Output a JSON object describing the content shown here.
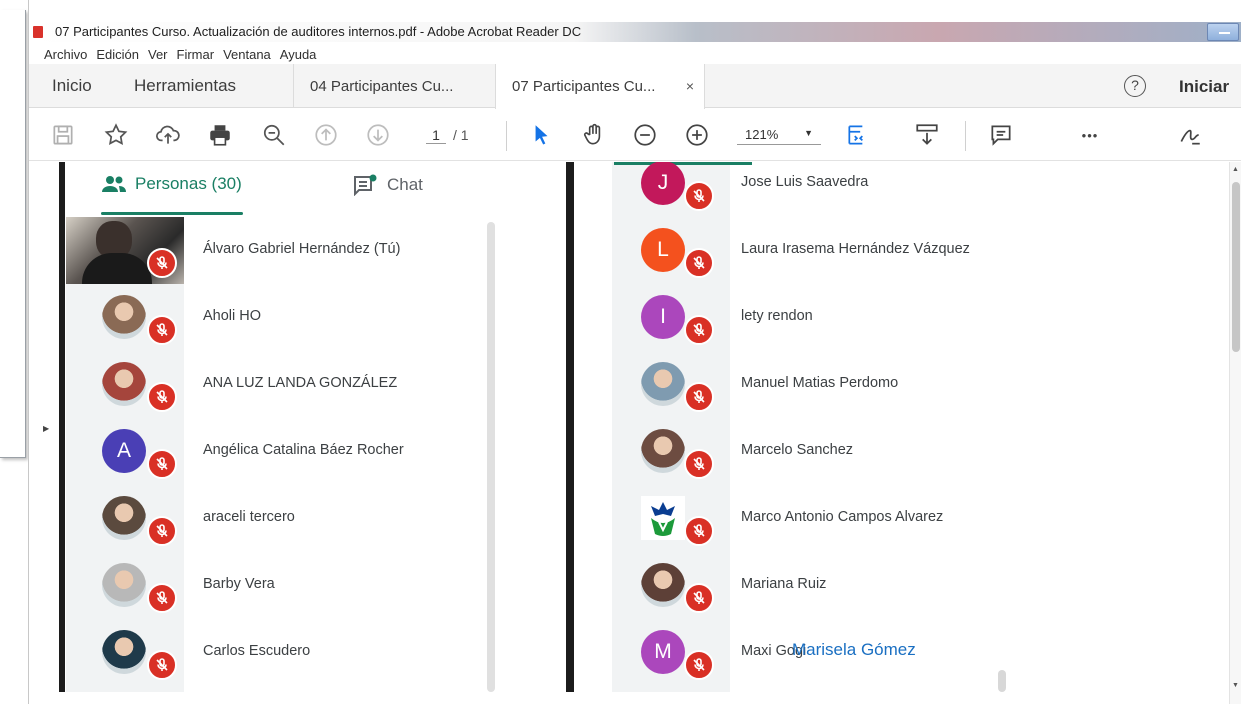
{
  "window": {
    "title": "07 Participantes Curso. Actualización de auditores internos.pdf - Adobe Acrobat Reader DC"
  },
  "menu": [
    "Archivo",
    "Edición",
    "Ver",
    "Firmar",
    "Ventana",
    "Ayuda"
  ],
  "tabs": {
    "home": "Inicio",
    "tools": "Herramientas",
    "docs": [
      {
        "label": "04 Participantes Cu..."
      },
      {
        "label": "07 Participantes Cu...",
        "close": "×"
      }
    ],
    "help": "?",
    "signin": "Iniciar"
  },
  "toolbar": {
    "icons": [
      "save-icon",
      "star-icon",
      "upload-icon",
      "print-icon",
      "zoom-search-icon",
      "page-up-icon",
      "page-down-icon",
      "cursor-icon",
      "hand-icon",
      "zoom-out-icon",
      "zoom-in-icon",
      "fit-page-icon",
      "scroll-mode-icon",
      "comment-icon",
      "more-icon",
      "sign-icon"
    ],
    "page_current": "1",
    "page_total": "/ 1",
    "zoom": "121%",
    "more": "•••"
  },
  "meet": {
    "people_tab": "Personas (30)",
    "chat_tab": "Chat",
    "accent": "#1a7f64",
    "mute_color": "#d93025"
  },
  "participants_left": [
    {
      "name": "Álvaro Gabriel Hernández (Tú)",
      "avatar": "video"
    },
    {
      "name": "Aholi HO",
      "avatar": "photo",
      "color": "#8a6a55"
    },
    {
      "name": "ANA LUZ LANDA GONZÁLEZ",
      "avatar": "photo",
      "color": "#a5453c"
    },
    {
      "name": "Angélica Catalina Báez Rocher",
      "avatar": "letter",
      "letter": "A",
      "color": "#4a3fb5"
    },
    {
      "name": "araceli tercero",
      "avatar": "photo",
      "color": "#5b4a3e"
    },
    {
      "name": "Barby Vera",
      "avatar": "photo",
      "color": "#b8b8b8"
    },
    {
      "name": "Carlos Escudero",
      "avatar": "photo",
      "color": "#1f3a4a"
    }
  ],
  "participants_right": [
    {
      "name": "Jose Luis Saavedra",
      "avatar": "letter",
      "letter": "J",
      "color": "#c2185b"
    },
    {
      "name": "Laura Irasema Hernández Vázquez",
      "avatar": "letter",
      "letter": "L",
      "color": "#f4511e"
    },
    {
      "name": "lety rendon",
      "avatar": "letter",
      "letter": "I",
      "color": "#ab47bc"
    },
    {
      "name": "Manuel Matias Perdomo",
      "avatar": "photo",
      "color": "#7f9bb0"
    },
    {
      "name": "Marcelo Sanchez",
      "avatar": "photo",
      "color": "#6d4c41"
    },
    {
      "name": "Marco Antonio Campos Alvarez",
      "avatar": "logo",
      "color": "#ffffff"
    },
    {
      "name": "Mariana Ruiz",
      "avatar": "photo",
      "color": "#5d4037"
    },
    {
      "name": "Maxi Gogi",
      "avatar": "letter",
      "letter": "M",
      "color": "#ab47bc"
    }
  ],
  "annotation": "Marisela Gómez"
}
